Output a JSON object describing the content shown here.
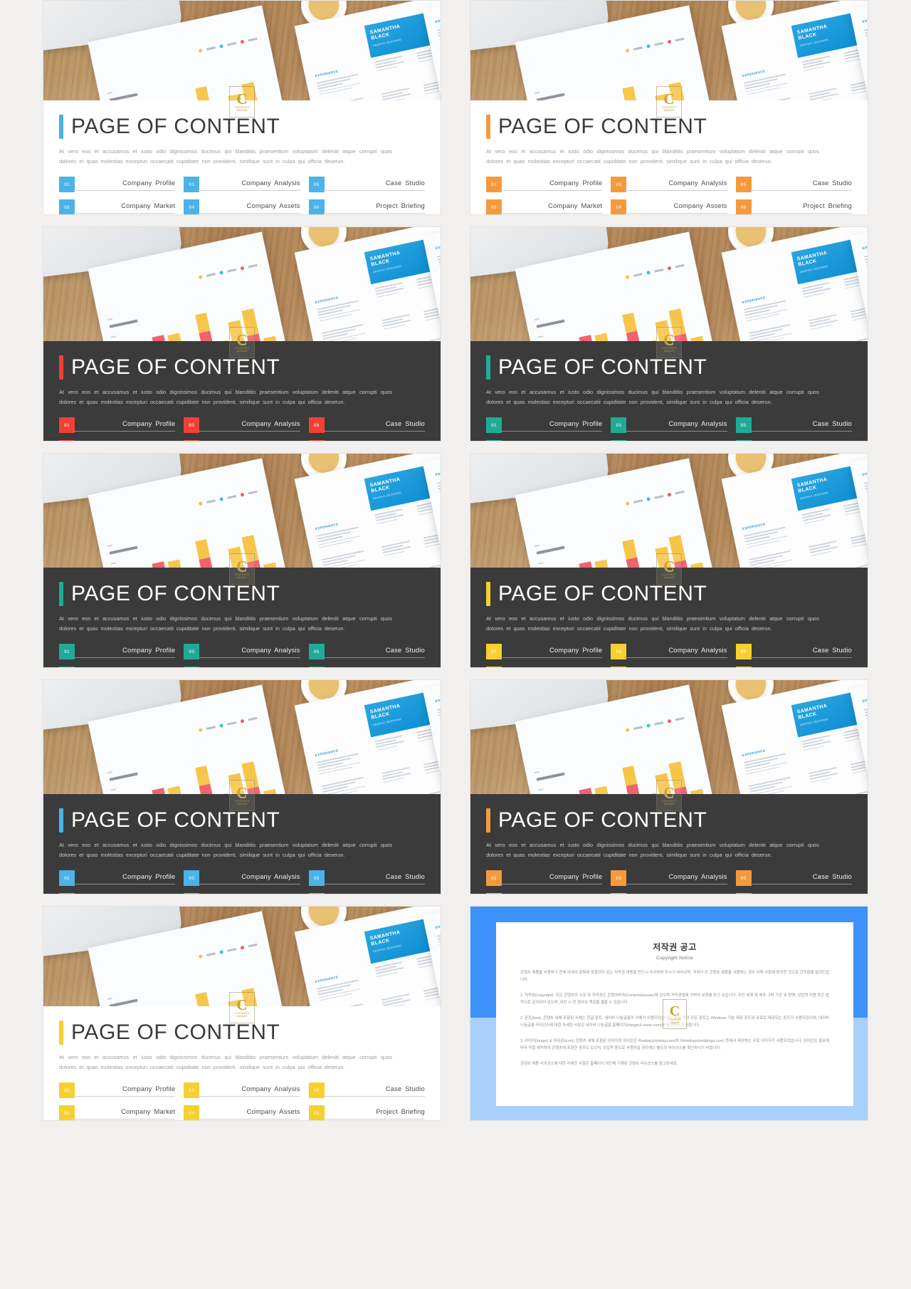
{
  "slide": {
    "title": "PAGE OF CONTENT",
    "paragraph": "At vero eos et accusamus et iusto odio dignissimos ducimus qui blanditiis praesentium voluptatum deleniti atque corrupti quos dolores et quas molestias excepturi occaecatii cupiditate non provident, similique sunt in culpa qui officia deserun.",
    "items": [
      {
        "num": "01",
        "label": "Company Profile"
      },
      {
        "num": "03",
        "label": "Company Analysis"
      },
      {
        "num": "05",
        "label": "Case Studio"
      },
      {
        "num": "02",
        "label": "Company Market"
      },
      {
        "num": "04",
        "label": "Company Assets"
      },
      {
        "num": "06",
        "label": "Project Briefing"
      }
    ]
  },
  "watermark": {
    "letter": "C",
    "caption_1": "CONTENTS",
    "caption_2": "BAZAAR"
  },
  "variants": [
    {
      "id": "v1",
      "theme": "light",
      "accent": "#4ab3e8",
      "name": "blue-light"
    },
    {
      "id": "v2",
      "theme": "light",
      "accent": "#f59a3c",
      "name": "orange-light"
    },
    {
      "id": "v3",
      "theme": "dark",
      "accent": "#ef4136",
      "name": "red-dark"
    },
    {
      "id": "v4",
      "theme": "dark",
      "accent": "#1fab96",
      "name": "teal-dark"
    },
    {
      "id": "v5",
      "theme": "dark",
      "accent": "#1fab96",
      "name": "teal-dark-2"
    },
    {
      "id": "v6",
      "theme": "dark",
      "accent": "#f6d031",
      "name": "yellow-dark"
    },
    {
      "id": "v7",
      "theme": "dark",
      "accent": "#4ab3e8",
      "name": "blue-dark"
    },
    {
      "id": "v8",
      "theme": "dark",
      "accent": "#f59a3c",
      "name": "orange-dark"
    },
    {
      "id": "v9",
      "theme": "light",
      "accent": "#f6d031",
      "name": "yellow-light"
    }
  ],
  "copyright": {
    "title_ko": "저작권 공고",
    "title_en": "Copyright Notice",
    "intro": "콘텐츠 제품을 사용하기 전에 아래의 항목에 포함되어 있는 저작권 내용을 반드시 숙지하여 주시기 바라오며, 귀하가 이 콘텐츠 제품을 사용하는 경우 아래 사항에 동의한 것으로 간주함을 알려드립니다.",
    "section_1": "1. 저작권(copyright): 모든 콘텐츠의 소유 및 저작권은 콘텐츠바자(Contentsbazaar)에 있으며 저작권법에 의하여 보호를 받고 있습니다. 무단 복제 및 배포, 2차 가공 및 판매, 상업적 이용 등은 법적으로 금지되어 있으며, 위반 시 민·형사상 책임을 물을 수 있습니다.",
    "section_2": "2. 폰트(font): 콘텐츠 내에 포함된 서체는 한글 폰트, 네이버 나눔글꼴의 서체가 사용되었습니다. 한글 외의 모든 폰트는 Windows 기본 제공 폰트와 무료로 제공되는 폰트가 사용되었으며, 네이버 나눔글꼴 라이선스에 대한 자세한 사항은 네이버 나눔글꼴 홈페이지(hangeul.naver.com)를 참고하시기 바랍니다.",
    "section_3": "3. 이미지(image) & 아이콘(icon): 콘텐츠 내에 포함된 이미지와 아이콘은 Pixabay(pixabay.com)와 Webdings(webdings.com) 등에서 제공하는 무료 이미지가 사용되었습니다. 아이콘은 필요에 따라 직접 제작하여 콘텐츠에 포함한 경우도 있으며, 상업적 용도로 사용하실 경우에는 별도의 라이선스를 확인하시기 바랍니다.",
    "outro": "콘텐츠 제품 라이선스에 대한 자세한 사항은 홈페이지 하단에 기재된 콘텐츠 라이선스를 참고하세요."
  }
}
